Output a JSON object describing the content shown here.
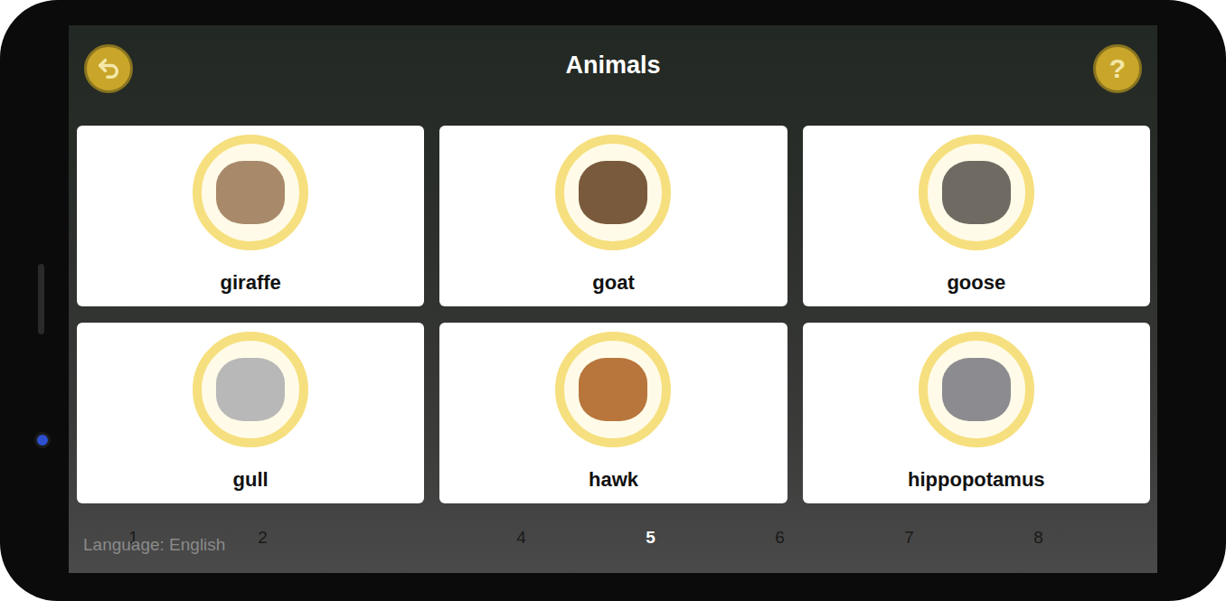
{
  "screen": {
    "title": "Animals"
  },
  "help_button": {
    "label": "?"
  },
  "cards": [
    {
      "label": "giraffe"
    },
    {
      "label": "goat"
    },
    {
      "label": "goose"
    },
    {
      "label": "gull"
    },
    {
      "label": "hawk"
    },
    {
      "label": "hippopotamus"
    }
  ],
  "pages": [
    {
      "label": "1",
      "selected": false
    },
    {
      "label": "2",
      "selected": false
    },
    {
      "label": "4",
      "selected": false
    },
    {
      "label": "5",
      "selected": true
    },
    {
      "label": "6",
      "selected": false
    },
    {
      "label": "7",
      "selected": false
    },
    {
      "label": "8",
      "selected": false
    }
  ],
  "language": "Language: English"
}
